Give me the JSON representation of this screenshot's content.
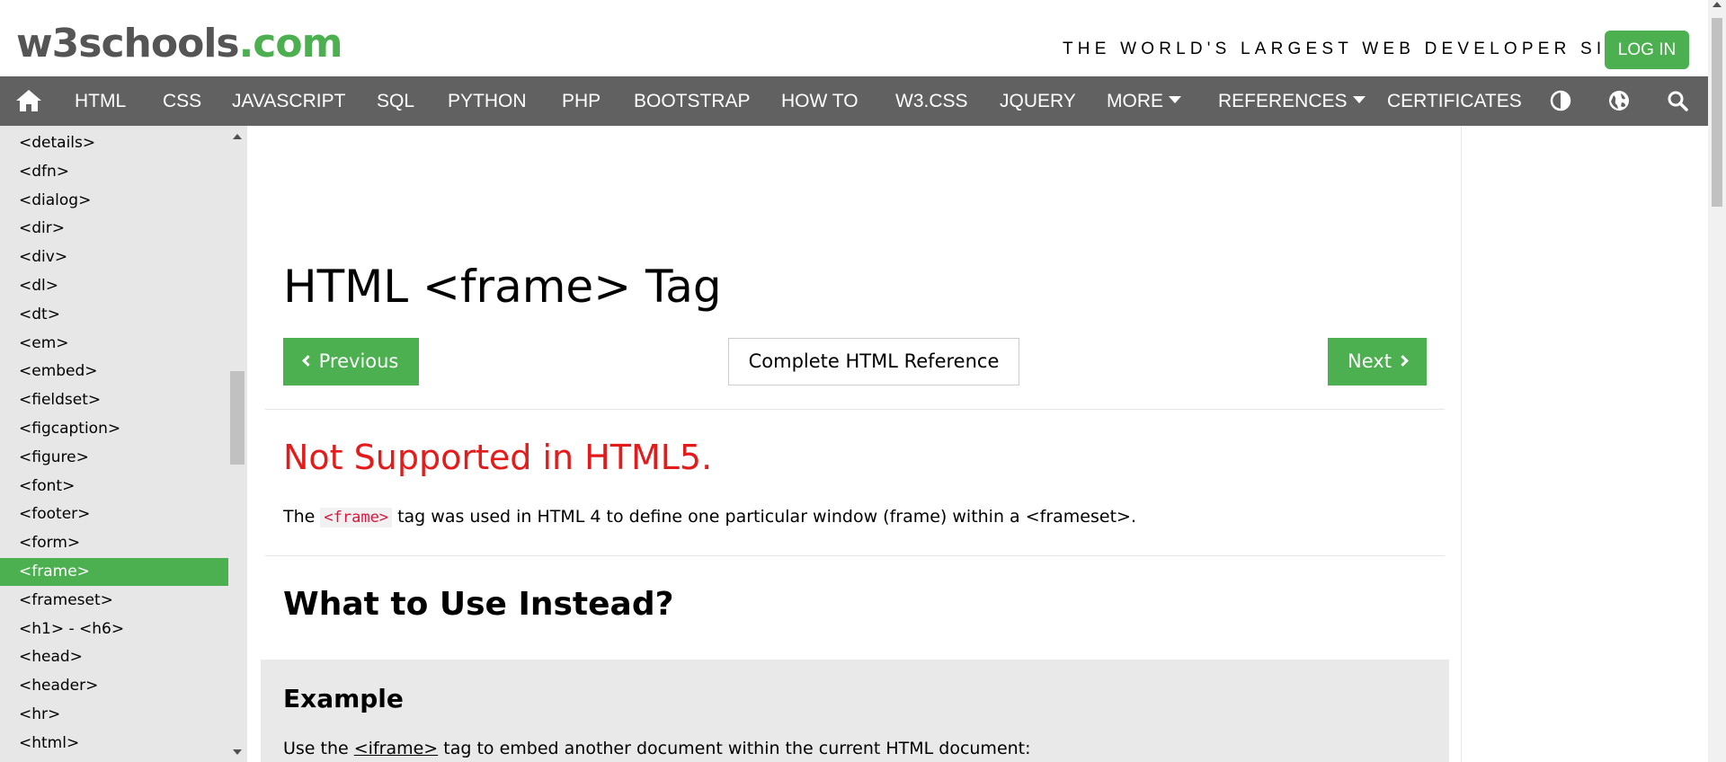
{
  "header": {
    "logo_main": "w3schools",
    "logo_suffix": ".com",
    "tagline": "THE WORLD'S LARGEST WEB DEVELOPER SITE",
    "login_label": "LOG IN",
    "accent_color": "#4caf50"
  },
  "nav": {
    "home_icon": "home-icon",
    "items": [
      "HTML",
      "CSS",
      "JAVASCRIPT",
      "SQL",
      "PYTHON",
      "PHP",
      "BOOTSTRAP",
      "HOW TO",
      "W3.CSS",
      "JQUERY",
      "MORE",
      "REFERENCES",
      "CERTIFICATES"
    ],
    "icons": [
      "contrast-icon",
      "globe-icon",
      "search-icon"
    ]
  },
  "sidebar": {
    "items": [
      "<details>",
      "<dfn>",
      "<dialog>",
      "<dir>",
      "<div>",
      "<dl>",
      "<dt>",
      "<em>",
      "<embed>",
      "<fieldset>",
      "<figcaption>",
      "<figure>",
      "<font>",
      "<footer>",
      "<form>",
      "<frame>",
      "<frameset>",
      "<h1> - <h6>",
      "<head>",
      "<header>",
      "<hr>",
      "<html>"
    ],
    "active": "<frame>"
  },
  "main": {
    "title": "HTML <frame> Tag",
    "prev_label": "Previous",
    "ref_label": "Complete HTML Reference",
    "next_label": "Next",
    "not_supported": "Not Supported in HTML5.",
    "desc_before": "The",
    "desc_code": "<frame>",
    "desc_after": "tag was used in HTML 4 to define one particular window (frame) within a <frameset>.",
    "section_title": "What to Use Instead?",
    "example_title": "Example",
    "example_before": "Use the",
    "example_link": "<iframe>",
    "example_after": "tag to embed another document within the current HTML document:"
  }
}
